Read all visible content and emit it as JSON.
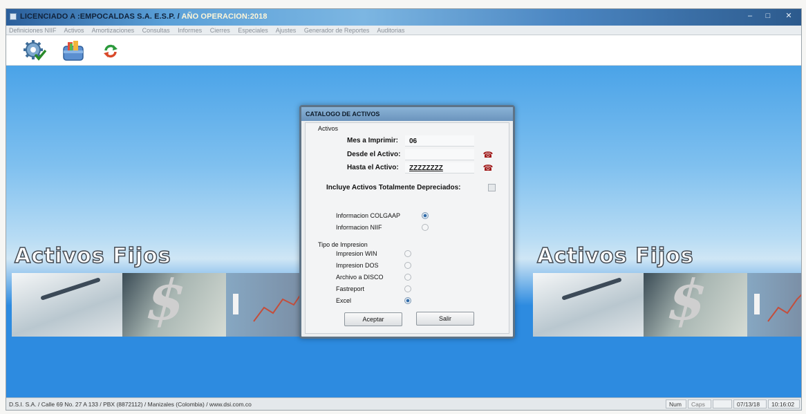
{
  "window": {
    "title": "LICENCIADO A :EMPOCALDAS S.A. E.S.P.  /  AÑO OPERACION:2018",
    "title_main": "LICENCIADO A :EMPOCALDAS S.A. E.S.P.",
    "title_sep": "  /  ",
    "title_year": "AÑO OPERACION:2018",
    "minimize": "–",
    "maximize": "□",
    "close": "✕"
  },
  "menu": [
    "Definiciones NIIF",
    "Activos",
    "Amortizaciones",
    "Consultas",
    "Informes",
    "Cierres",
    "Especiales",
    "Ajustes",
    "Generador de Reportes",
    "Auditorias"
  ],
  "toolbar": {
    "icons": [
      "gear-check-icon",
      "briefcase-icon",
      "sync-arrows-icon"
    ]
  },
  "background": {
    "banner_left": "Activos Fijos",
    "banner_right": "Activos Fijos"
  },
  "dialog": {
    "title": "CATALOGO DE ACTIVOS",
    "group_label": "Activos",
    "mes_label": "Mes a Imprimir:",
    "mes_value": "06",
    "desde_label": "Desde el Activo:",
    "desde_value": "",
    "hasta_label": "Hasta el Activo:",
    "hasta_value": "ZZZZZZZZ",
    "incluye_label": "Incluye Activos Totalmente Depreciados:",
    "incluye_checked": false,
    "info_options": [
      {
        "label": "Informacion COLGAAP",
        "selected": true
      },
      {
        "label": "Informacion NIIF",
        "selected": false
      }
    ],
    "tipo_label": "Tipo de Impresion",
    "tipo_options": [
      {
        "label": "Impresion WIN",
        "selected": false
      },
      {
        "label": "Impresion DOS",
        "selected": false
      },
      {
        "label": "Archivo a DISCO",
        "selected": false
      },
      {
        "label": "Fastreport",
        "selected": false
      },
      {
        "label": "Excel",
        "selected": true
      }
    ],
    "accept_button": "Aceptar",
    "exit_button": "Salir"
  },
  "status": {
    "address": "D.S.I. S.A. / Calle 69 No. 27 A 133 / PBX (8872112) / Manizales (Colombia) / www.dsi.com.co",
    "num": "Num",
    "caps": "Caps",
    "date": "07/13/18",
    "time": "10:16:02"
  },
  "colors": {
    "accent_blue": "#2d8be0",
    "title_blue": "#4b86c2"
  }
}
